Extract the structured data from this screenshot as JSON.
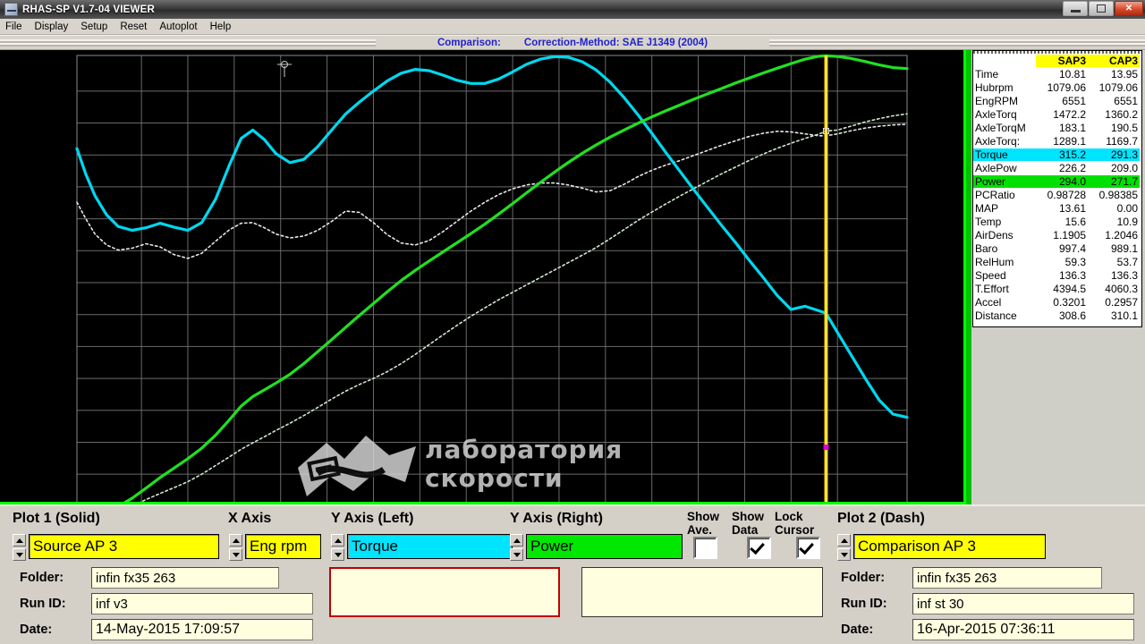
{
  "window": {
    "title": "RHAS-SP V1.7-04  VIEWER",
    "icon": "app-icon",
    "buttons": {
      "minimize": "minimize",
      "maximize": "maximize",
      "close": "✕"
    }
  },
  "menu": {
    "items": [
      "File",
      "Display",
      "Setup",
      "Reset",
      "Autoplot",
      "Help"
    ]
  },
  "header": {
    "comparison_label": "Comparison:",
    "correction_method": "Correction-Method: SAE J1349 (2004)"
  },
  "chart_data": {
    "type": "line",
    "title": "",
    "xlabel": "Eng rpm",
    "ylabel_left": "Torque",
    "ylabel_right": "Power",
    "grid": true,
    "xlim": [
      3322,
      6900
    ],
    "left_ylim": [
      283.02,
      355.58
    ],
    "right_ylim": [
      156.8,
      294.1
    ],
    "x_ticks": [
      3322,
      3600,
      3800,
      4000,
      4200,
      4400,
      4600,
      4800,
      5000,
      5200,
      5400,
      5600,
      5800,
      6000,
      6200,
      6400,
      6600,
      6900
    ],
    "left_ticks": [
      "355.58",
      "350.00",
      "345.00",
      "340.00",
      "335.00",
      "330.00",
      "325.00",
      "320.00",
      "315.00",
      "310.00",
      "305.00",
      "300.00",
      "295.00",
      "290.00",
      "283.02"
    ],
    "right_ticks": [
      "294.1",
      "280.0",
      "270.0",
      "260.0",
      "250.0",
      "240.0",
      "230.0",
      "220.0",
      "210.0",
      "200.0",
      "190.0",
      "180.0",
      "170.0",
      "156.8"
    ],
    "cursor_rpm": 6551,
    "colors": {
      "torque": "#00d8f0",
      "power": "#21e021",
      "dash": "#e8e8e8",
      "cursor": "#ffd000",
      "background": "#000000",
      "grid": "#6a6a6a"
    },
    "series": [
      {
        "name": "Torque (Plot 1 Solid)",
        "axis": "left",
        "style": "solid",
        "color": "#00d8f0",
        "x": [
          3322,
          3360,
          3400,
          3450,
          3500,
          3560,
          3620,
          3680,
          3740,
          3800,
          3860,
          3920,
          3980,
          4030,
          4080,
          4130,
          4180,
          4240,
          4300,
          4360,
          4420,
          4480,
          4540,
          4600,
          4660,
          4720,
          4780,
          4840,
          4900,
          4960,
          5020,
          5080,
          5140,
          5200,
          5260,
          5320,
          5380,
          5440,
          5500,
          5560,
          5620,
          5680,
          5740,
          5800,
          5860,
          5920,
          5980,
          6040,
          6100,
          6160,
          6220,
          6280,
          6340,
          6400,
          6460,
          6520,
          6551,
          6600,
          6660,
          6720,
          6780,
          6840,
          6900
        ],
        "y": [
          341.0,
          337.0,
          333.6,
          330.6,
          328.8,
          328.2,
          328.6,
          329.3,
          328.7,
          328.2,
          329.4,
          333.1,
          338.5,
          342.6,
          343.9,
          342.4,
          340.2,
          338.8,
          339.3,
          341.3,
          343.9,
          346.4,
          348.3,
          350.0,
          351.6,
          352.8,
          353.4,
          353.2,
          352.5,
          351.7,
          351.2,
          351.2,
          351.9,
          353.0,
          354.2,
          355.0,
          355.4,
          355.3,
          354.6,
          353.3,
          351.4,
          349.0,
          346.3,
          343.4,
          340.4,
          337.5,
          334.6,
          331.8,
          329.0,
          326.3,
          323.5,
          320.8,
          318.0,
          315.8,
          316.3,
          315.6,
          315.2,
          312.2,
          308.6,
          305.0,
          301.6,
          299.4,
          298.9
        ]
      },
      {
        "name": "Power (Plot 1 Solid)",
        "axis": "right",
        "style": "solid",
        "color": "#21e021",
        "x": [
          3322,
          3360,
          3400,
          3450,
          3500,
          3560,
          3620,
          3680,
          3740,
          3800,
          3860,
          3920,
          3980,
          4030,
          4080,
          4130,
          4180,
          4240,
          4300,
          4360,
          4420,
          4480,
          4540,
          4600,
          4660,
          4720,
          4780,
          4840,
          4900,
          4960,
          5020,
          5080,
          5140,
          5200,
          5260,
          5320,
          5380,
          5440,
          5500,
          5560,
          5620,
          5680,
          5740,
          5800,
          5860,
          5920,
          5980,
          6040,
          6100,
          6160,
          6220,
          6280,
          6340,
          6400,
          6460,
          6520,
          6551,
          6600,
          6660,
          6720,
          6780,
          6840,
          6900
        ],
        "y": [
          157.5,
          157.0,
          157.4,
          158.6,
          160.4,
          162.9,
          165.9,
          169.0,
          171.8,
          174.6,
          177.7,
          181.6,
          186.2,
          190.2,
          193.0,
          195.0,
          197.0,
          199.6,
          202.8,
          206.3,
          209.9,
          213.5,
          217.1,
          220.6,
          224.1,
          227.4,
          230.4,
          233.2,
          235.9,
          238.6,
          241.3,
          244.1,
          247.1,
          250.2,
          253.4,
          256.5,
          259.5,
          262.4,
          265.1,
          267.6,
          269.9,
          272.0,
          274.0,
          275.9,
          277.7,
          279.4,
          281.1,
          282.7,
          284.3,
          285.9,
          287.4,
          288.9,
          290.3,
          291.7,
          293.0,
          293.9,
          294.0,
          293.8,
          293.2,
          292.3,
          291.3,
          290.5,
          290.2
        ]
      },
      {
        "name": "Torque (Plot 2 Dash)",
        "axis": "left",
        "style": "dash",
        "color": "#e8e8e8",
        "x": [
          3322,
          3360,
          3400,
          3450,
          3500,
          3560,
          3620,
          3680,
          3740,
          3800,
          3860,
          3920,
          3980,
          4030,
          4080,
          4130,
          4180,
          4240,
          4300,
          4360,
          4420,
          4480,
          4540,
          4600,
          4660,
          4720,
          4780,
          4840,
          4900,
          4960,
          5020,
          5080,
          5140,
          5200,
          5260,
          5320,
          5380,
          5440,
          5500,
          5560,
          5620,
          5680,
          5740,
          5800,
          5860,
          5920,
          5980,
          6040,
          6100,
          6160,
          6220,
          6280,
          6340,
          6400,
          6460,
          6520,
          6551,
          6600,
          6660,
          6720,
          6780,
          6840,
          6900
        ],
        "y": [
          332.6,
          330.0,
          327.6,
          325.9,
          325.1,
          325.4,
          326.1,
          325.6,
          324.4,
          323.8,
          324.6,
          326.5,
          328.3,
          329.3,
          329.4,
          328.6,
          327.6,
          327.0,
          327.3,
          328.2,
          329.6,
          331.2,
          331.0,
          329.4,
          327.5,
          326.2,
          325.9,
          326.6,
          328.0,
          329.6,
          331.2,
          332.6,
          333.8,
          334.7,
          335.3,
          335.6,
          335.6,
          335.3,
          334.8,
          334.2,
          334.4,
          335.4,
          336.6,
          337.6,
          338.4,
          339.1,
          339.9,
          340.7,
          341.5,
          342.2,
          342.9,
          343.4,
          343.7,
          343.6,
          343.3,
          343.0,
          343.0,
          343.3,
          343.8,
          344.2,
          344.5,
          344.7,
          344.8
        ]
      },
      {
        "name": "Power (Plot 2 Dash)",
        "axis": "right",
        "style": "dash",
        "color": "#cfe8cf",
        "x": [
          3322,
          3360,
          3400,
          3450,
          3500,
          3560,
          3620,
          3680,
          3740,
          3800,
          3860,
          3920,
          3980,
          4030,
          4080,
          4130,
          4180,
          4240,
          4300,
          4360,
          4420,
          4480,
          4540,
          4600,
          4660,
          4720,
          4780,
          4840,
          4900,
          4960,
          5020,
          5080,
          5140,
          5200,
          5260,
          5320,
          5380,
          5440,
          5500,
          5560,
          5620,
          5680,
          5740,
          5800,
          5860,
          5920,
          5980,
          6040,
          6100,
          6160,
          6220,
          6280,
          6340,
          6400,
          6460,
          6520,
          6551,
          6600,
          6660,
          6720,
          6780,
          6840,
          6900
        ],
        "y": [
          156.8,
          156.9,
          157.2,
          157.9,
          159.0,
          160.6,
          162.5,
          164.3,
          166.0,
          167.8,
          170.0,
          172.6,
          175.2,
          177.4,
          179.3,
          181.1,
          183.0,
          185.1,
          187.4,
          189.8,
          192.3,
          194.6,
          196.6,
          198.4,
          200.4,
          202.8,
          205.5,
          208.4,
          211.3,
          214.1,
          216.8,
          219.3,
          221.7,
          223.9,
          226.1,
          228.3,
          230.5,
          232.7,
          234.9,
          237.2,
          239.8,
          242.5,
          245.2,
          247.7,
          250.1,
          252.4,
          254.6,
          256.8,
          259.0,
          261.0,
          263.0,
          264.9,
          266.6,
          268.1,
          269.5,
          270.8,
          271.7,
          272.0,
          273.2,
          274.4,
          275.4,
          276.2,
          276.8
        ]
      }
    ]
  },
  "data_panel": {
    "columns": [
      "SAP3",
      "CAP3"
    ],
    "rows": [
      {
        "label": "Time",
        "v1": "10.81",
        "v2": "13.95",
        "hl": "none"
      },
      {
        "label": "Hubrpm",
        "v1": "1079.06",
        "v2": "1079.06",
        "hl": "none"
      },
      {
        "label": "EngRPM",
        "v1": "6551",
        "v2": "6551",
        "hl": "none"
      },
      {
        "label": "AxleTorq",
        "v1": "1472.2",
        "v2": "1360.2",
        "hl": "none"
      },
      {
        "label": "AxleTorqM",
        "v1": "183.1",
        "v2": "190.5",
        "hl": "none"
      },
      {
        "label": "AxleTorq:",
        "v1": "1289.1",
        "v2": "1169.7",
        "hl": "none"
      },
      {
        "label": "Torque",
        "v1": "315.2",
        "v2": "291.3",
        "hl": "cyan"
      },
      {
        "label": "AxlePow",
        "v1": "226.2",
        "v2": "209.0",
        "hl": "none"
      },
      {
        "label": "Power",
        "v1": "294.0",
        "v2": "271.7",
        "hl": "green"
      },
      {
        "label": "PCRatio",
        "v1": "0.98728",
        "v2": "0.98385",
        "hl": "none"
      },
      {
        "label": "MAP",
        "v1": "13.61",
        "v2": "0.00",
        "hl": "none"
      },
      {
        "label": "Temp",
        "v1": "15.6",
        "v2": "10.9",
        "hl": "none"
      },
      {
        "label": "AirDens",
        "v1": "1.1905",
        "v2": "1.2046",
        "hl": "none"
      },
      {
        "label": "Baro",
        "v1": "997.4",
        "v2": "989.1",
        "hl": "none"
      },
      {
        "label": "RelHum",
        "v1": "59.3",
        "v2": "53.7",
        "hl": "none"
      },
      {
        "label": "Speed",
        "v1": "136.3",
        "v2": "136.3",
        "hl": "none"
      },
      {
        "label": "T.Effort",
        "v1": "4394.5",
        "v2": "4060.3",
        "hl": "none"
      },
      {
        "label": "Accel",
        "v1": "0.3201",
        "v2": "0.2957",
        "hl": "none"
      },
      {
        "label": "Distance",
        "v1": "308.6",
        "v2": "310.1",
        "hl": "none"
      }
    ]
  },
  "controls": {
    "plot1": {
      "title": "Plot 1 (Solid)",
      "value": "Source AP 3"
    },
    "xaxis": {
      "title": "X Axis",
      "value": "Eng rpm"
    },
    "yleft": {
      "title": "Y Axis (Left)",
      "value": "Torque"
    },
    "yright": {
      "title": "Y Axis (Right)",
      "value": "Power"
    },
    "show_ave": {
      "title_line1": "Show",
      "title_line2": "Ave.",
      "checked": false
    },
    "show_data": {
      "title_line1": "Show",
      "title_line2": "Data",
      "checked": true
    },
    "lock_cursor": {
      "title_line1": "Lock",
      "title_line2": "Cursor",
      "checked": true
    },
    "plot2": {
      "title": "Plot 2 (Dash)",
      "value": "Comparison AP 3"
    }
  },
  "run_left": {
    "folder_label": "Folder:",
    "folder_value": "infin fx35 263",
    "runid_label": "Run ID:",
    "runid_value": "inf v3",
    "date_label": "Date:",
    "date_value": "14-May-2015  17:09:57"
  },
  "run_right": {
    "folder_label": "Folder:",
    "folder_value": "infin fx35 263",
    "runid_label": "Run ID:",
    "runid_value": "inf st 30",
    "date_label": "Date:",
    "date_value": "16-Apr-2015  07:36:11"
  },
  "watermark": {
    "line1": "лаборатория",
    "line2": "скорости"
  }
}
